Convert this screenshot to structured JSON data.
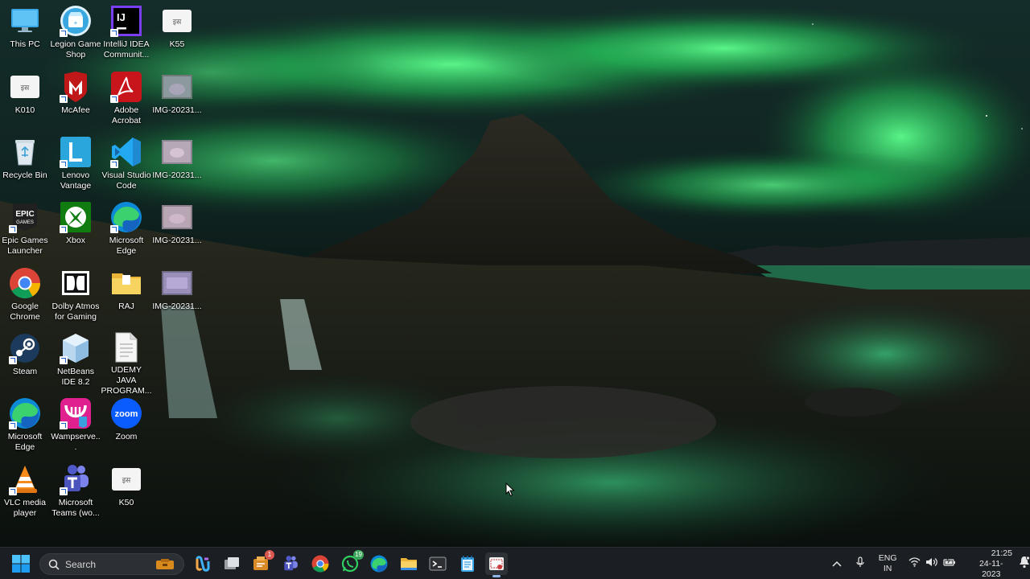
{
  "desktop": {
    "icons": [
      {
        "label": "This PC",
        "icon": "monitor-icon"
      },
      {
        "label": "Legion Game Shop",
        "icon": "legion-shop-icon"
      },
      {
        "label": "IntelliJ IDEA Communit...",
        "icon": "intellij-icon"
      },
      {
        "label": "K55",
        "icon": "document-icon"
      },
      {
        "label": "K010",
        "icon": "document-icon"
      },
      {
        "label": "McAfee",
        "icon": "mcafee-icon"
      },
      {
        "label": "Adobe Acrobat",
        "icon": "acrobat-icon"
      },
      {
        "label": "IMG-20231...",
        "icon": "image-thumbnail-icon"
      },
      {
        "label": "Recycle Bin",
        "icon": "recycle-bin-icon"
      },
      {
        "label": "Lenovo Vantage",
        "icon": "lenovo-vantage-icon"
      },
      {
        "label": "Visual Studio Code",
        "icon": "vscode-icon"
      },
      {
        "label": "IMG-20231...",
        "icon": "image-thumbnail-icon"
      },
      {
        "label": "Epic Games Launcher",
        "icon": "epic-games-icon",
        "logo_text": "EPIC GAMES"
      },
      {
        "label": "Xbox",
        "icon": "xbox-icon"
      },
      {
        "label": "Microsoft Edge",
        "icon": "edge-icon"
      },
      {
        "label": "IMG-20231...",
        "icon": "image-thumbnail-icon"
      },
      {
        "label": "Google Chrome",
        "icon": "chrome-icon"
      },
      {
        "label": "Dolby Atmos for Gaming",
        "icon": "dolby-icon"
      },
      {
        "label": "RAJ",
        "icon": "folder-icon"
      },
      {
        "label": "IMG-20231...",
        "icon": "image-thumbnail-icon"
      },
      {
        "label": "Steam",
        "icon": "steam-icon"
      },
      {
        "label": "NetBeans IDE 8.2",
        "icon": "netbeans-icon"
      },
      {
        "label": "UDEMY JAVA PROGRAM...",
        "icon": "text-file-icon"
      },
      {
        "label": "Microsoft Edge",
        "icon": "edge-icon"
      },
      {
        "label": "Wampserve...",
        "icon": "wampserver-icon"
      },
      {
        "label": "Zoom",
        "icon": "zoom-icon",
        "logo_text": "zoom"
      },
      {
        "label": "VLC media player",
        "icon": "vlc-icon"
      },
      {
        "label": "Microsoft Teams (wo...",
        "icon": "teams-icon"
      },
      {
        "label": "K50",
        "icon": "document-icon"
      }
    ]
  },
  "taskbar": {
    "search_label": "Search",
    "apps": [
      {
        "name": "copilot",
        "icon": "copilot-icon"
      },
      {
        "name": "task-view",
        "icon": "task-view-icon"
      },
      {
        "name": "app-with-badge",
        "icon": "notification-app-icon",
        "badge": "1"
      },
      {
        "name": "teams",
        "icon": "teams-icon"
      },
      {
        "name": "chrome",
        "icon": "chrome-icon"
      },
      {
        "name": "whatsapp",
        "icon": "whatsapp-icon",
        "badge": "19"
      },
      {
        "name": "edge",
        "icon": "edge-icon"
      },
      {
        "name": "file-explorer",
        "icon": "folder-icon"
      },
      {
        "name": "terminal",
        "icon": "terminal-icon"
      },
      {
        "name": "notepad",
        "icon": "notepad-icon"
      },
      {
        "name": "snipping-tool",
        "icon": "snipping-tool-icon"
      }
    ],
    "tray": {
      "language_line1": "ENG",
      "language_line2": "IN",
      "time": "21:25",
      "date": "24-11-2023"
    }
  },
  "colors": {
    "taskbar_bg": "#1b1e22",
    "aurora": "#3bf07a",
    "accent": "#4a90e2"
  }
}
